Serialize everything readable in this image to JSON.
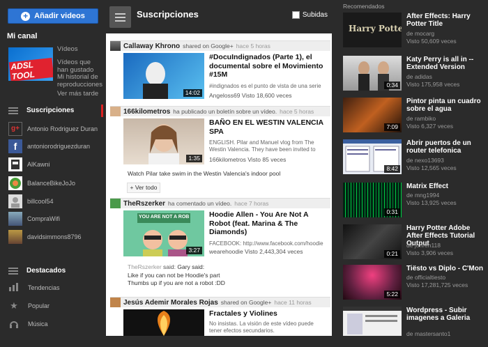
{
  "sidebar": {
    "upload_label": "Añadir videos",
    "my_channel": "Mi canal",
    "channel_logo_text": "ADSL TOOL",
    "channel_links": [
      "Vídeos",
      "Vídeos que han gustado",
      "Mi historial de reproducciones",
      "Ver más tarde"
    ],
    "subscriptions_label": "Suscripciones",
    "subscriptions": [
      {
        "name": "Antonio Rodriguez Duran",
        "color": "#2a2a2a"
      },
      {
        "name": "antoniorodriguezduran",
        "color": "#3b5998"
      },
      {
        "name": "AlKawni",
        "color": "#555555"
      },
      {
        "name": "BalanceBikeJoJo",
        "color": "#4a9e3a"
      },
      {
        "name": "billcool54",
        "color": "#dddddd"
      },
      {
        "name": "CompraWifi",
        "color": "#6a8fc0"
      },
      {
        "name": "davidsimmons8796",
        "color": "#8a6a2a"
      }
    ],
    "featured_label": "Destacados",
    "categories": [
      {
        "name": "Tendencias",
        "icon": "bar-chart-icon"
      },
      {
        "name": "Popular",
        "icon": "star-icon"
      },
      {
        "name": "Música",
        "icon": "headphones-icon"
      }
    ]
  },
  "main": {
    "title": "Suscripciones",
    "uploads_label": "Subidas",
    "feed": [
      {
        "user": "Callaway Khrono",
        "action": "shared on Google+",
        "time": "hace 5 horas",
        "title": "#DocuIndignados (Parte 1), el documental sobre el Movimiento #15M",
        "desc": "#indignados es el punto de vista de una serie",
        "meta": "Angeloss69 Visto 18,600 veces",
        "duration": "14:02"
      },
      {
        "user": "166kilometros",
        "action": "ha publicado un boletín sobre un vídeo.",
        "time": "hace 5 horas",
        "title": "BAÑO EN EL WESTIN VALENCIA SPA",
        "desc": "ENGLISH. Pilar and Manuel vlog from The Westin Valencia. They have been invited to spend the",
        "meta": "166kilometros Visto 85 veces",
        "duration": "1:35",
        "extra": "Watch Pilar take swim in the Westin Valencia's indoor pool",
        "more": "+ Ver todo"
      },
      {
        "user": "TheRszerker",
        "action": "ha comentado un vídeo.",
        "time": "hace 7 horas",
        "title": "Hoodie Allen - You Are Not A Robot (feat. Marina & The Diamonds)",
        "desc": "FACEBOOK: http://www.facebook.com/hoodie",
        "meta": "wearehoodie Visto 2,443,304 veces",
        "duration": "3:27",
        "thumb_text": "YOU ARE NOT A ROBOT",
        "comment_user": "TheRszerker",
        "comment_said": "said:",
        "comment_lines": [
          "Gary said:",
          "Like if you can not be Hoodie's part",
          "Thumbs up if you are not a robot :DD"
        ]
      },
      {
        "user": "Jesús Ademir Morales Rojas",
        "action": "shared on Google+",
        "time": "hace 11 horas",
        "title": "Fractales y Violines",
        "desc": "No insistas. La visión de este vídeo puede tener efectos secundarios."
      }
    ]
  },
  "recommended": {
    "label": "Recomendados",
    "items": [
      {
        "title": "After Effects: Harry Potter Title",
        "by": "de mocarg",
        "views": "Visto 50,609 veces",
        "duration": "",
        "thumb_text": "Harry Potter"
      },
      {
        "title": "Katy Perry is all in -- Extended Version",
        "by": "de adidas",
        "views": "Visto 175,958 veces",
        "duration": "0:34"
      },
      {
        "title": "Pintor pinta un cuadro sobre el agua",
        "by": "de rambiko",
        "views": "Visto 6,327 veces",
        "duration": "7:09"
      },
      {
        "title": "Abrir puertos de un router telefonica",
        "by": "de nexo13693",
        "views": "Visto 12,565 veces",
        "duration": "8:42"
      },
      {
        "title": "Matrix Effect",
        "by": "de mng1994",
        "views": "Visto 13,925 veces",
        "duration": "0:31"
      },
      {
        "title": "Harry Potter Adobe After Effects Tutorial Output",
        "by": "de johren118",
        "views": "Visto 3,906 veces",
        "duration": "0:21"
      },
      {
        "title": "Tiësto vs Diplo - C'Mon",
        "by": "de officialtiesto",
        "views": "Visto 17,281,725 veces",
        "duration": "5:22"
      },
      {
        "title": "Wordpress - Subir imagenes a Galeria",
        "by": "de mastersanto1",
        "views": "",
        "duration": ""
      }
    ]
  },
  "colors": {
    "accent": "#2e75d4",
    "active": "#dd2222"
  }
}
